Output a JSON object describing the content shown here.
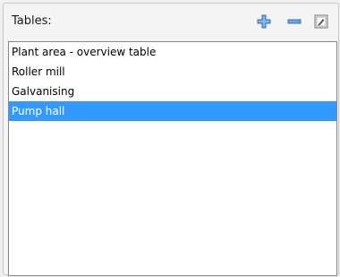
{
  "panel": {
    "title": "Tables:"
  },
  "toolbar": {
    "add_icon": "plus-icon",
    "remove_icon": "minus-icon",
    "edit_icon": "edit-icon"
  },
  "tables": {
    "items": [
      {
        "label": "Plant area - overview table",
        "selected": false
      },
      {
        "label": "Roller mill",
        "selected": false
      },
      {
        "label": "Galvanising",
        "selected": false
      },
      {
        "label": "Pump hall",
        "selected": true
      }
    ]
  },
  "colors": {
    "selection": "#3399ff",
    "icon_blue": "#4a7fc1"
  }
}
